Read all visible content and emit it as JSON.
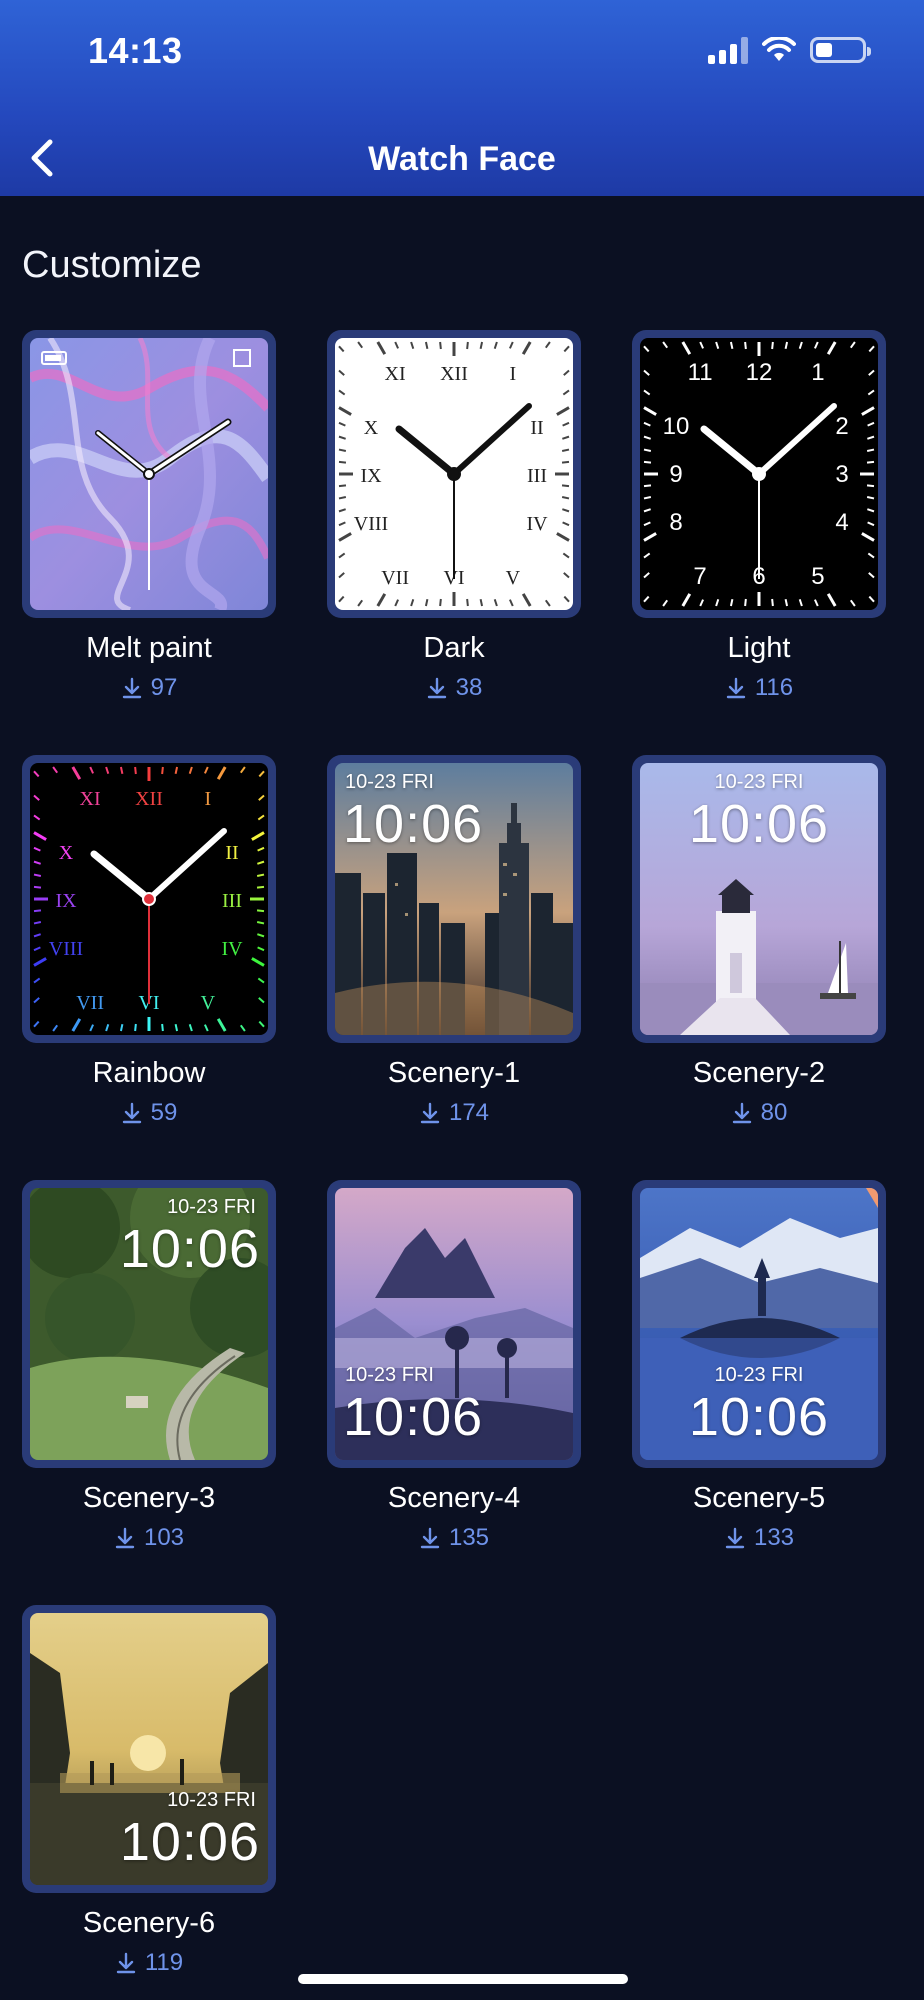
{
  "status_bar": {
    "time": "14:13"
  },
  "header": {
    "title": "Watch Face"
  },
  "section_title": "Customize",
  "faces": [
    {
      "name": "Melt paint",
      "downloads": "97",
      "style": "melt-paint"
    },
    {
      "name": "Dark",
      "downloads": "38",
      "style": "roman-white"
    },
    {
      "name": "Light",
      "downloads": "116",
      "style": "arabic-black"
    },
    {
      "name": "Rainbow",
      "downloads": "59",
      "style": "rainbow-roman"
    },
    {
      "name": "Scenery-1",
      "downloads": "174",
      "style": "city-photo",
      "date": "10-23 FRI",
      "time": "10:06"
    },
    {
      "name": "Scenery-2",
      "downloads": "80",
      "style": "lighthouse-photo",
      "date": "10-23 FRI",
      "time": "10:06"
    },
    {
      "name": "Scenery-3",
      "downloads": "103",
      "style": "forest-photo",
      "date": "10-23 FRI",
      "time": "10:06"
    },
    {
      "name": "Scenery-4",
      "downloads": "135",
      "style": "mountain-mist-photo",
      "date": "10-23 FRI",
      "time": "10:06"
    },
    {
      "name": "Scenery-5",
      "downloads": "133",
      "style": "lake-island-photo",
      "date": "10-23 FRI",
      "time": "10:06"
    },
    {
      "name": "Scenery-6",
      "downloads": "119",
      "style": "sunset-photo",
      "date": "10-23 FRI",
      "time": "10:06"
    }
  ],
  "dial_numerals": {
    "roman": [
      "XII",
      "I",
      "II",
      "III",
      "IV",
      "V",
      "VI",
      "VII",
      "VIII",
      "IX",
      "X",
      "XI"
    ],
    "arabic": [
      "12",
      "1",
      "2",
      "3",
      "4",
      "5",
      "6",
      "7",
      "8",
      "9",
      "10",
      "11"
    ]
  },
  "colors": {
    "header": "#2448bd",
    "background": "#0b1022",
    "tile_frame": "#2a3b78",
    "count": "#6f93ea"
  }
}
